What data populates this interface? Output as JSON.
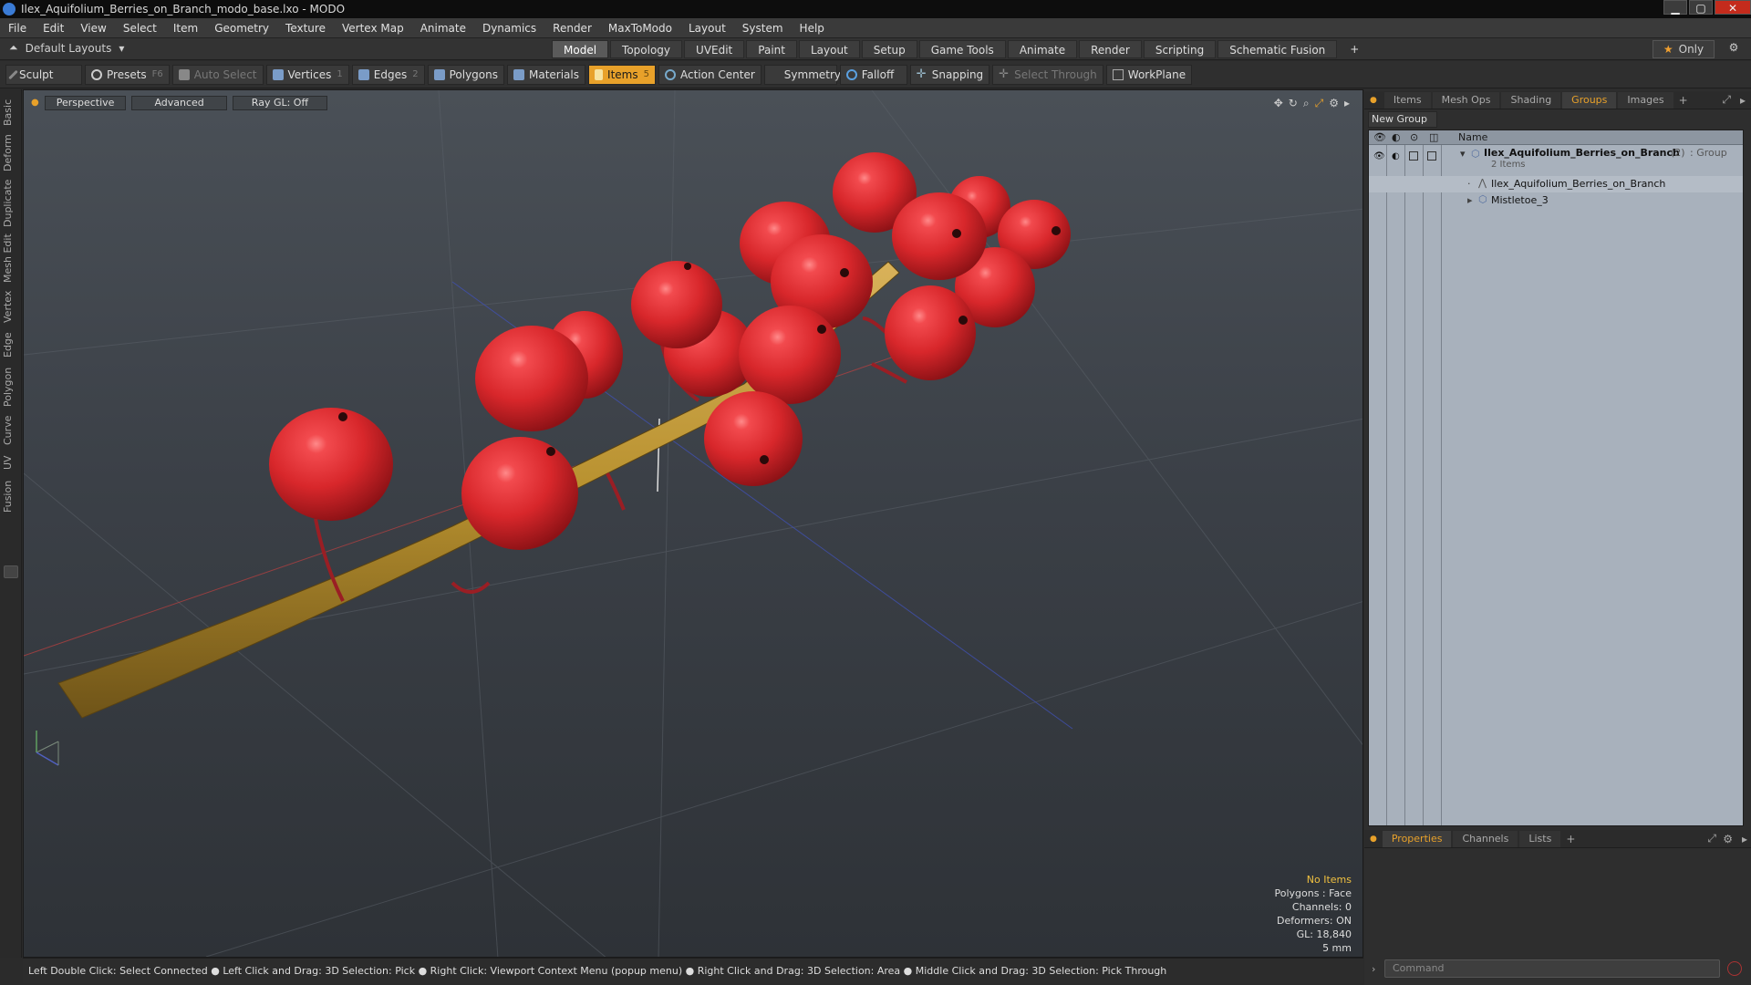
{
  "window": {
    "title": "Ilex_Aquifolium_Berries_on_Branch_modo_base.lxo - MODO",
    "minimize": "▁",
    "maximize": "▢",
    "close": "✕"
  },
  "menu": [
    "File",
    "Edit",
    "View",
    "Select",
    "Item",
    "Geometry",
    "Texture",
    "Vertex Map",
    "Animate",
    "Dynamics",
    "Render",
    "MaxToModo",
    "Layout",
    "System",
    "Help"
  ],
  "layoutbar": {
    "layouts_label": "Default Layouts",
    "tabs": [
      "Model",
      "Topology",
      "UVEdit",
      "Paint",
      "Layout",
      "Setup",
      "Game Tools",
      "Animate",
      "Render",
      "Scripting",
      "Schematic Fusion"
    ],
    "active_tab": "Model",
    "add": "+",
    "only_label": "Only"
  },
  "toolbar": {
    "sculpt": "Sculpt",
    "presets": "Presets",
    "presets_key": "F6",
    "auto_select": "Auto Select",
    "vertices": "Vertices",
    "vertices_count": "1",
    "edges": "Edges",
    "edges_count": "2",
    "polygons": "Polygons",
    "materials": "Materials",
    "items": "Items",
    "items_count": "5",
    "action_center": "Action Center",
    "symmetry": "Symmetry",
    "falloff": "Falloff",
    "snapping": "Snapping",
    "select_through": "Select Through",
    "workplane": "WorkPlane"
  },
  "left_tabs": [
    "Basic",
    "Deform",
    "Duplicate",
    "Mesh Edit",
    "Vertex",
    "Edge",
    "Polygon",
    "Curve",
    "UV",
    "Fusion"
  ],
  "viewport": {
    "perspective": "Perspective",
    "advanced": "Advanced",
    "raygl": "Ray GL: Off",
    "info": {
      "no_items": "No Items",
      "polygons": "Polygons : Face",
      "channels": "Channels: 0",
      "deformers": "Deformers: ON",
      "gl": "GL: 18,840",
      "scale": "5 mm"
    }
  },
  "statusbar": "Left Double Click: Select Connected ● Left Click and Drag: 3D Selection: Pick ● Right Click: Viewport Context Menu (popup menu) ● Right Click and Drag: 3D Selection: Area ● Middle Click and Drag: 3D Selection: Pick Through",
  "panel": {
    "tabs": [
      "Items",
      "Mesh Ops",
      "Shading",
      "Groups",
      "Images"
    ],
    "active_tab": "Groups",
    "new_group": "New Group",
    "name_header": "Name",
    "group": {
      "name": "Ilex_Aquifolium_Berries_on_Branch",
      "count": "(2)",
      "type": ": Group",
      "items_label": "2 Items",
      "children": [
        "Ilex_Aquifolium_Berries_on_Branch",
        "Mistletoe_3"
      ]
    },
    "bottom_tabs": [
      "Properties",
      "Channels",
      "Lists"
    ],
    "bottom_active": "Properties",
    "command_placeholder": "Command"
  },
  "colors": {
    "accent": "#e8a12a",
    "berry": "#d8272b",
    "branch": "#b8912f"
  }
}
